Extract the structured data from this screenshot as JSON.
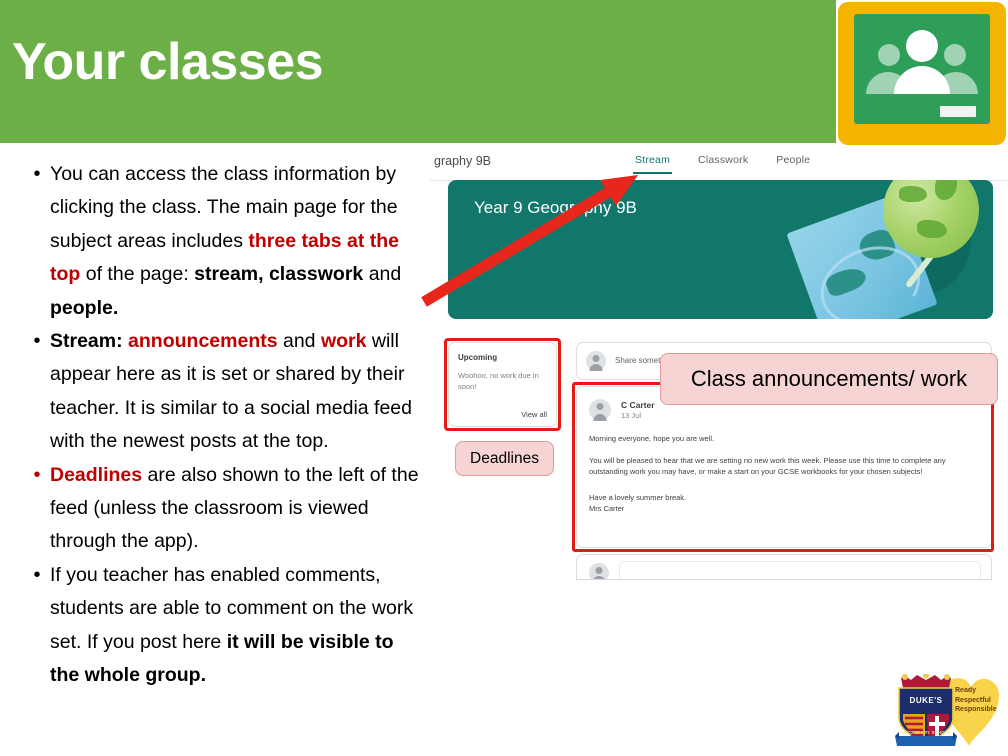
{
  "slide": {
    "title": "Your classes",
    "banner_color": "#6CAF47"
  },
  "logo": {
    "name": "google-classroom-logo",
    "frame_color": "#F5B400",
    "board_color": "#2E9E58"
  },
  "bullets": [
    {
      "marker_color": "black",
      "segments": [
        {
          "text": "You can access the class information by clicking the class. The main page for the subject areas includes ",
          "style": "normal"
        },
        {
          "text": "three tabs at the top",
          "style": "red-bold"
        },
        {
          "text": " of the page: ",
          "style": "normal"
        },
        {
          "text": "stream, classwork",
          "style": "bold"
        },
        {
          "text": " and ",
          "style": "normal"
        },
        {
          "text": "people.",
          "style": "bold"
        }
      ]
    },
    {
      "marker_color": "black",
      "segments": [
        {
          "text": "Stream:",
          "style": "bold"
        },
        {
          "text": " ",
          "style": "normal"
        },
        {
          "text": "announcements",
          "style": "red-bold"
        },
        {
          "text": " and ",
          "style": "normal"
        },
        {
          "text": "work",
          "style": "red-bold"
        },
        {
          "text": " will appear here as it is set or shared by their teacher. It is similar to a social media feed with the newest posts at the top.",
          "style": "normal"
        }
      ]
    },
    {
      "marker_color": "red",
      "segments": [
        {
          "text": "Deadlines",
          "style": "red-bold"
        },
        {
          "text": " are also shown to the left of the feed (unless the classroom is viewed through the app).",
          "style": "normal"
        }
      ]
    },
    {
      "marker_color": "black",
      "segments": [
        {
          "text": "If you teacher has enabled comments, students are able to comment on the work set. If you post here ",
          "style": "normal"
        },
        {
          "text": "it will be visible to the whole group.",
          "style": "bold"
        }
      ]
    }
  ],
  "classroom": {
    "class_name_partial": "graphy 9B",
    "tabs": [
      {
        "label": "Stream",
        "active": true
      },
      {
        "label": "Classwork",
        "active": false
      },
      {
        "label": "People",
        "active": false
      }
    ],
    "hero_title": "Year 9 Geography 9B",
    "hero_color": "#11776B",
    "upcoming": {
      "title": "Upcoming",
      "body": "Woohoo, no work due in soon!",
      "view_all": "View all"
    },
    "share_bar": {
      "placeholder": "Share somet"
    },
    "post": {
      "author": "C Carter",
      "date": "13 Jul",
      "paragraph1": "Morning everyone, hope you are well.",
      "paragraph2": "You will be pleased to hear that we are setting no new work this week. Please use this time to complete any outstanding work you may have, or make a start on your GCSE workbooks for your chosen subjects!",
      "paragraph3": "Have a lovely summer break.",
      "paragraph4": "Mrs Carter"
    }
  },
  "callouts": {
    "deadlines": "Deadlines",
    "announcements": "Class announcements/ work",
    "fill_color": "#F7D4D4",
    "highlight_color": "#E21B15"
  },
  "crest": {
    "school_name": "DUKE'S",
    "banner_text": "SECONDARY SCHOOL",
    "values": "Ready\nRespectful\nResponsible"
  }
}
